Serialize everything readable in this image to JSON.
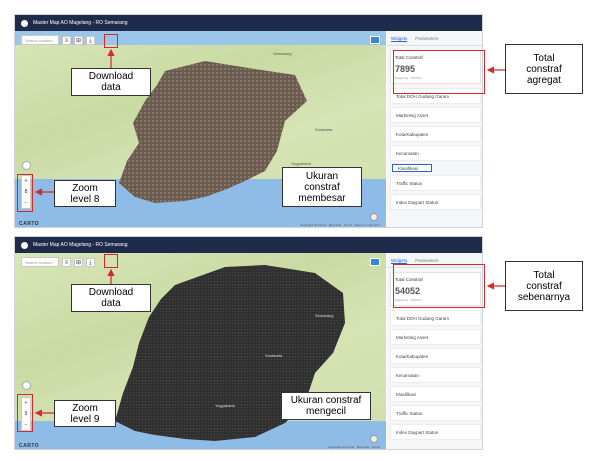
{
  "panels": [
    {
      "title": "Master Map AO Magelang - RO Semarang",
      "search_placeholder": "Search location",
      "tabs": [
        "Widgets",
        "Parameters"
      ],
      "total_label": "Total Constraf",
      "total_value": "7895",
      "total_sub": "Magelang · 06/2022",
      "widgets": [
        "Total DOH Gudang Garam",
        "Marketing Asset",
        "Kota/Kabupaten",
        "Kecamatan",
        "Klasifikasi",
        "Traffic Status",
        "Index Daypart Status"
      ],
      "map_labels": [
        "Yogyakarta",
        "SPECIAL",
        "OF YOG",
        "Surakarta",
        "Semarang"
      ],
      "zoom": {
        "plus": "+",
        "level": "8",
        "minus": "−"
      },
      "carto": "CARTO",
      "attribution": "Keyboard shortcuts · Map data · Terms · Report a map error",
      "watermark": "Activate Windows"
    },
    {
      "title": "Master Map AO Magelang - RO Semarang",
      "search_placeholder": "Search location",
      "tabs": [
        "Widgets",
        "Parameters"
      ],
      "total_label": "Total Constraf",
      "total_value": "54052",
      "total_sub": "Magelang · 06/2022",
      "widgets": [
        "Total DOH Gudang Garam",
        "Marketing Asset",
        "Kota/Kabupaten",
        "Kecamatan",
        "Klasifikasi",
        "Traffic Status",
        "Index Daypart Status"
      ],
      "map_labels": [
        "Semarang",
        "Surakarta",
        "Yogyakarta"
      ],
      "zoom": {
        "plus": "+",
        "level": "9",
        "minus": "−"
      },
      "carto": "CARTO",
      "attribution": "Keyboard shortcuts · Map data · Terms",
      "watermark": "Activate Windows"
    }
  ],
  "callouts": {
    "download1": "Download\ndata",
    "zoom1": "Zoom\nlevel 8",
    "size1": "Ukuran\nconstraf\nmembesar",
    "total1": "Total\nconstraf\nagregat",
    "download2": "Download\ndata",
    "zoom2": "Zoom\nlevel 9",
    "size2": "Ukuran constraf\nmengecil",
    "total2": "Total\nconstraf\nsebenarnya"
  },
  "colors": {
    "titlebar": "#1f2b4a",
    "accent": "#2a62c9",
    "annotation": "#d42a2a",
    "region1": "#6b5b4f",
    "region2": "#2f2f2f"
  }
}
